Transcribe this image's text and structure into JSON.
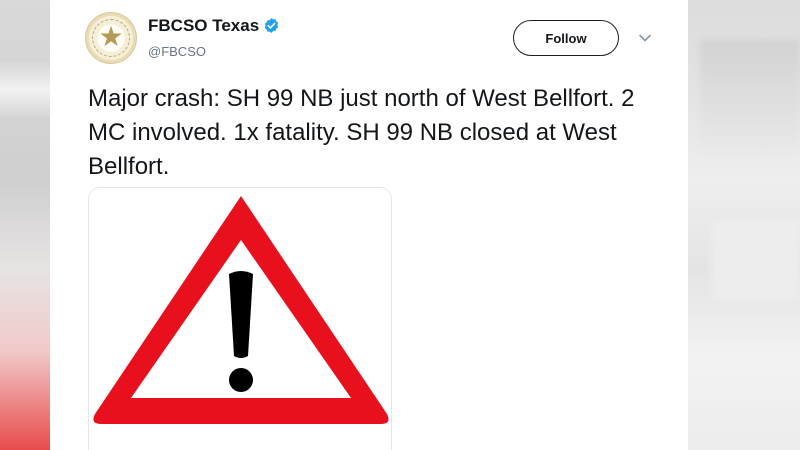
{
  "tweet": {
    "display_name": "FBCSO Texas",
    "handle": "@FBCSO",
    "verified": true,
    "follow_label": "Follow",
    "text": "Major crash: SH 99 NB just north of West Bellfort. 2 MC involved. 1x fatality. SH 99 NB closed at West Bellfort.",
    "avatar_icon": "sheriff-badge-star",
    "media_icon": "warning-triangle-exclamation"
  },
  "colors": {
    "verified_blue": "#1da1f2",
    "warning_red": "#e8101d",
    "text_primary": "#14171a",
    "text_secondary": "#657786"
  }
}
